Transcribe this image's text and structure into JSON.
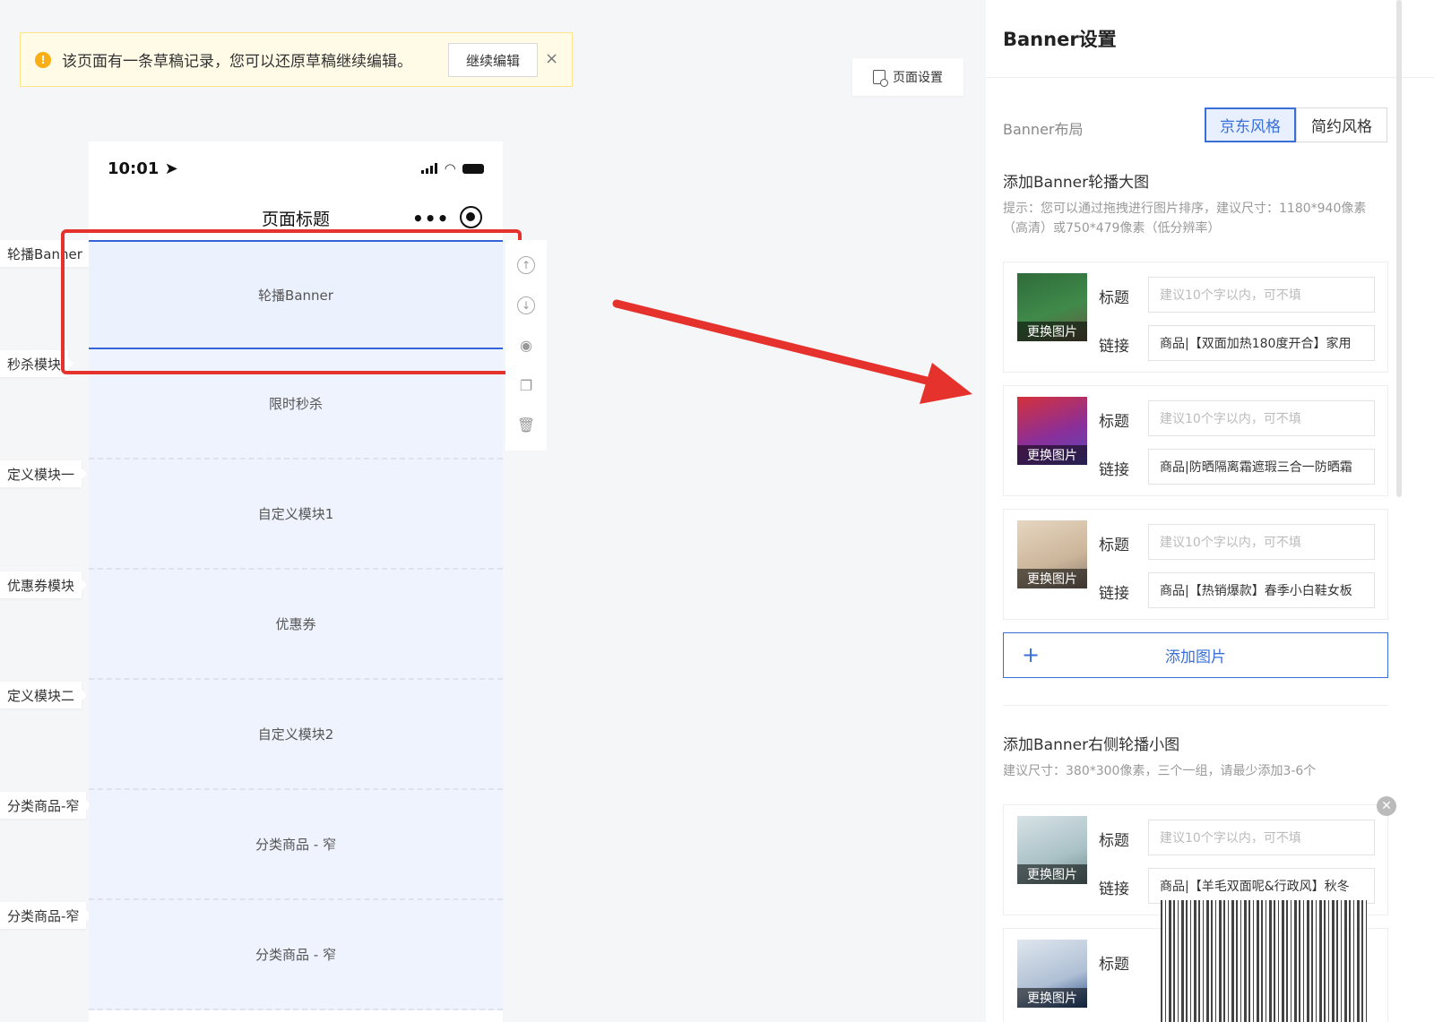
{
  "notice": {
    "text": "该页面有一条草稿记录，您可以还原草稿继续编辑。",
    "continue_label": "继续编辑",
    "close_label": "×",
    "icon": "warning-icon",
    "color": "#faad14"
  },
  "page_settings_label": "页面设置",
  "phone": {
    "time": "10:01",
    "page_title": "页面标题",
    "modules": [
      "轮播Banner",
      "限时秒杀",
      "自定义模块1",
      "优惠券",
      "自定义模块2",
      "分类商品 - 窄",
      "分类商品 - 窄"
    ]
  },
  "side_labels": [
    "轮播Banner",
    "秒杀模块",
    "定义模块一",
    "优惠券模块",
    "定义模块二",
    "分类商品-窄",
    "分类商品-窄"
  ],
  "panel": {
    "title": "Banner设置",
    "layout_label": "Banner布局",
    "layout_options": [
      "京东风格",
      "简约风格"
    ],
    "selected_layout": "京东风格",
    "main_section": {
      "title": "添加Banner轮播大图",
      "hint": "提示：您可以通过拖拽进行图片排序，建议尺寸：1180*940像素（高清）或750*479像素（低分辨率）",
      "items": [
        {
          "title_placeholder": "建议10个字以内，可不填",
          "link": "商品|【双面加热180度开合】家用",
          "thumb_caption": "更换图片"
        },
        {
          "title_placeholder": "建议10个字以内，可不填",
          "link": "商品|防晒隔离霜遮瑕三合一防晒霜",
          "thumb_caption": "更换图片"
        },
        {
          "title_placeholder": "建议10个字以内，可不填",
          "link": "商品|【热销爆款】春季小白鞋女板",
          "thumb_caption": "更换图片"
        }
      ],
      "add_label": "添加图片"
    },
    "side_section": {
      "title": "添加Banner右侧轮播小图",
      "hint": "建议尺寸：380*300像素，三个一组，请最少添加3-6个",
      "items": [
        {
          "title_placeholder": "建议10个字以内，可不填",
          "link": "商品|【羊毛双面呢&行政风】秋冬",
          "thumb_caption": "更换图片"
        },
        {
          "title_placeholder": "",
          "link": "",
          "thumb_caption": "更换图片"
        }
      ]
    },
    "field_title": "标题",
    "field_link": "链接",
    "accent": "#3a6fd8"
  },
  "highlight_color": "#e6322d"
}
